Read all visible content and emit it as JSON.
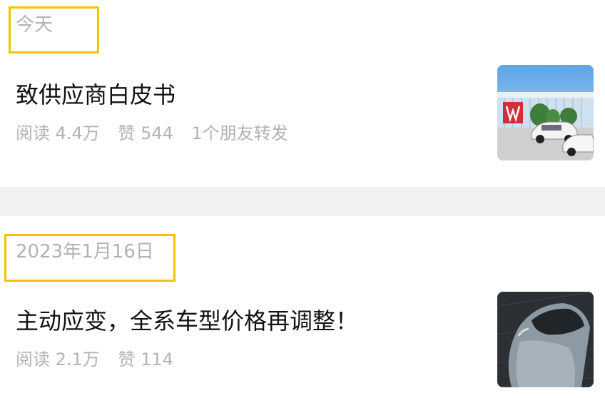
{
  "groups": [
    {
      "date": "今天",
      "article": {
        "title": "致供应商白皮书",
        "reads": "阅读 4.4万",
        "likes": "赞 544",
        "shares": "1个朋友转发",
        "thumb_icon": "building-cars-thumbnail"
      }
    },
    {
      "date": "2023年1月16日",
      "article": {
        "title": "主动应变，全系车型价格再调整！",
        "reads": "阅读 2.1万",
        "likes": "赞 114",
        "thumb_icon": "car-top-thumbnail"
      }
    }
  ],
  "colors": {
    "highlight_box": "#f6c200",
    "meta_text": "#b2b2b2",
    "title_text": "#111111",
    "divider": "#f2f2f2"
  }
}
